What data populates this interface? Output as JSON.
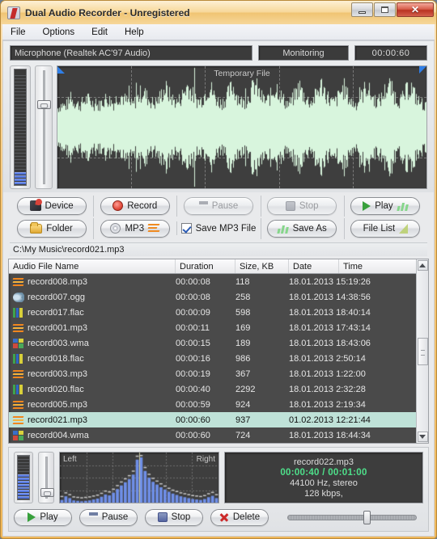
{
  "window": {
    "title": "Dual Audio Recorder - Unregistered",
    "app_icon": "app-icon",
    "minimize_label": "",
    "maximize_label": "",
    "close_label": "✕"
  },
  "menu": [
    {
      "label": "File"
    },
    {
      "label": "Options"
    },
    {
      "label": "Edit"
    },
    {
      "label": "Help"
    }
  ],
  "status": {
    "device": "Microphone (Realtek AC'97 Audio)",
    "state": "Monitoring",
    "elapsed": "00:00:60"
  },
  "waveform": {
    "title": "Temporary File",
    "wave_color": "#d8f5dd",
    "bg_color": "#3e3e3e",
    "grid_color": "#8d8d8d",
    "marker_color": "#2f7fe8"
  },
  "toolbar": {
    "row1": [
      {
        "label": "Device",
        "icon": "device-icon",
        "disabled": false
      },
      {
        "label": "Record",
        "icon": "record-icon",
        "disabled": false
      },
      {
        "label": "Pause",
        "icon": "pause-icon",
        "disabled": true
      },
      {
        "label": "Stop",
        "icon": "stop-icon",
        "disabled": true
      },
      {
        "label": "Play",
        "icon": "play-icon",
        "disabled": false
      }
    ],
    "row2": {
      "folder": "Folder",
      "mp3": "MP3",
      "save_mp3_checkbox": "Save MP3 File",
      "save_mp3_checked": true,
      "save_as": "Save As",
      "file_list": "File List"
    }
  },
  "path": "C:\\My Music\\record021.mp3",
  "file_list": {
    "columns": [
      "Audio File Name",
      "Duration",
      "Size, KB",
      "Date",
      "Time"
    ],
    "rows": [
      {
        "name": "record008.mp3",
        "type": "mp3",
        "duration": "00:00:08",
        "size": "118",
        "date": "18.01.2013",
        "time": "15:19:26",
        "selected": false
      },
      {
        "name": "record007.ogg",
        "type": "ogg",
        "duration": "00:00:08",
        "size": "258",
        "date": "18.01.2013",
        "time": "14:38:56",
        "selected": false
      },
      {
        "name": "record017.flac",
        "type": "flac",
        "duration": "00:00:09",
        "size": "598",
        "date": "18.01.2013",
        "time": "18:40:14",
        "selected": false
      },
      {
        "name": "record001.mp3",
        "type": "mp3",
        "duration": "00:00:11",
        "size": "169",
        "date": "18.01.2013",
        "time": "17:43:14",
        "selected": false
      },
      {
        "name": "record003.wma",
        "type": "wma",
        "duration": "00:00:15",
        "size": "189",
        "date": "18.01.2013",
        "time": "18:43:06",
        "selected": false
      },
      {
        "name": "record018.flac",
        "type": "flac",
        "duration": "00:00:16",
        "size": "986",
        "date": "18.01.2013",
        "time": "2:50:14",
        "selected": false
      },
      {
        "name": "record003.mp3",
        "type": "mp3",
        "duration": "00:00:19",
        "size": "367",
        "date": "18.01.2013",
        "time": "1:22:00",
        "selected": false
      },
      {
        "name": "record020.flac",
        "type": "flac",
        "duration": "00:00:40",
        "size": "2292",
        "date": "18.01.2013",
        "time": "2:32:28",
        "selected": false
      },
      {
        "name": "record005.mp3",
        "type": "mp3",
        "duration": "00:00:59",
        "size": "924",
        "date": "18.01.2013",
        "time": "2:19:34",
        "selected": false
      },
      {
        "name": "record021.mp3",
        "type": "mp3",
        "duration": "00:00:60",
        "size": "937",
        "date": "01.02.2013",
        "time": "12:21:44",
        "selected": true
      },
      {
        "name": "record004.wma",
        "type": "wma",
        "duration": "00:00:60",
        "size": "724",
        "date": "18.01.2013",
        "time": "18:44:34",
        "selected": false
      }
    ]
  },
  "player": {
    "spectrum_left_label": "Left",
    "spectrum_right_label": "Right",
    "info": {
      "file": "record022.mp3",
      "time": "00:00:40 / 00:01:00",
      "format": "44100 Hz, stereo",
      "bitrate": "128 kbps,"
    },
    "buttons": {
      "play": "Play",
      "pause": "Pause",
      "stop": "Stop",
      "delete": "Delete"
    },
    "progress_percent": 60
  },
  "chart_data": {
    "type": "area",
    "title": "Temporary File",
    "series": [
      {
        "name": "amplitude_envelope",
        "values": [
          0.42,
          0.5,
          0.46,
          0.55,
          0.6,
          0.52,
          0.48,
          0.58,
          0.62,
          0.55,
          0.5,
          0.47,
          0.57,
          0.63,
          0.59,
          0.52,
          0.66,
          0.7,
          0.61,
          0.54,
          0.49,
          0.58,
          0.72,
          0.8,
          0.66,
          0.57,
          0.52,
          0.6,
          0.74,
          0.85,
          0.71,
          0.6,
          0.55,
          0.63,
          0.78,
          0.92,
          0.75,
          0.62,
          0.56,
          0.64,
          0.8,
          0.88,
          0.7,
          0.58,
          0.53,
          0.61,
          0.76,
          0.9,
          0.73,
          0.59,
          0.54,
          0.62,
          0.79,
          0.95,
          0.77,
          0.63,
          0.57,
          0.65,
          0.81,
          0.87,
          0.69,
          0.56,
          0.51,
          0.59,
          0.75,
          0.89,
          0.72,
          0.6,
          0.55,
          0.64,
          0.82,
          0.93,
          0.76,
          0.61,
          0.53,
          0.6,
          0.77,
          0.86,
          0.68,
          0.55,
          0.5,
          0.58,
          0.73,
          0.91,
          0.74,
          0.62,
          0.56,
          0.63,
          0.8,
          0.94,
          0.78,
          0.64,
          0.58,
          0.66,
          0.83,
          0.88,
          0.7,
          0.57,
          0.52,
          0.45
        ]
      }
    ]
  },
  "spectrum_data": {
    "type": "bar",
    "channels": [
      "Left",
      "Right"
    ],
    "left_values": [
      0.06,
      0.14,
      0.1,
      0.05,
      0.04,
      0.03,
      0.04,
      0.05,
      0.07,
      0.09,
      0.13,
      0.18,
      0.16,
      0.22,
      0.3,
      0.38,
      0.45,
      0.52,
      0.62,
      0.95
    ],
    "right_values": [
      1.0,
      0.7,
      0.55,
      0.46,
      0.4,
      0.34,
      0.29,
      0.24,
      0.2,
      0.17,
      0.14,
      0.12,
      0.1,
      0.08,
      0.07,
      0.06,
      0.08,
      0.12,
      0.15,
      0.1
    ],
    "bar_color": "#6f8fe8"
  }
}
